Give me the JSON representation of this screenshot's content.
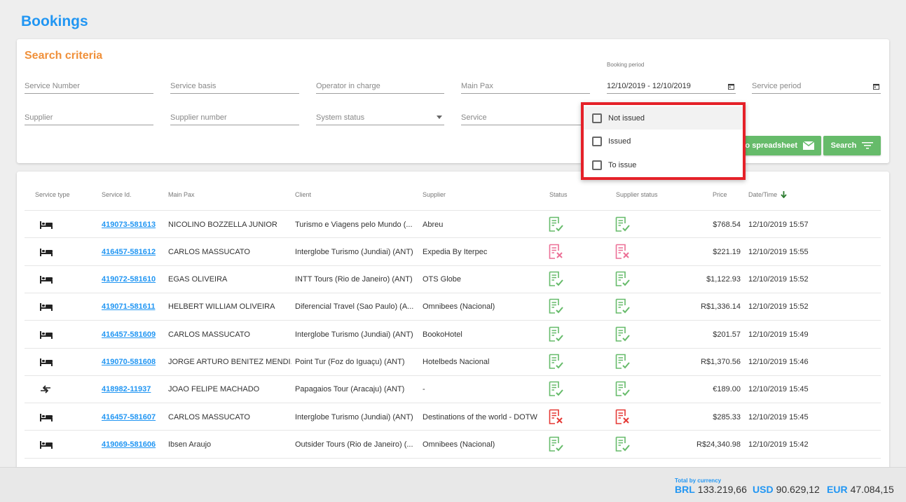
{
  "page_title": "Bookings",
  "search": {
    "title": "Search criteria",
    "service_number": "Service Number",
    "service_basis": "Service basis",
    "operator": "Operator in charge",
    "main_pax": "Main Pax",
    "booking_period_label": "Booking period",
    "booking_period_value": "12/10/2019 - 12/10/2019",
    "service_period": "Service period",
    "supplier": "Supplier",
    "supplier_number": "Supplier number",
    "system_status": "System status",
    "service": "Service",
    "export_button": "to spreadsheet",
    "search_button": "Search"
  },
  "dropdown": {
    "options": [
      "Not issued",
      "Issued",
      "To issue"
    ]
  },
  "table": {
    "headers": {
      "service_type": "Service type",
      "service_id": "Service Id.",
      "main_pax": "Main Pax",
      "client": "Client",
      "supplier": "Supplier",
      "status": "Status",
      "supplier_status": "Supplier status",
      "price": "Price",
      "datetime": "Date/Time"
    },
    "rows": [
      {
        "type": "bed-icon",
        "id": "419073-581613",
        "pax": "NICOLINO BOZZELLA JUNIOR",
        "client": "Turismo e Viagens pelo Mundo (...",
        "supplier": "Abreu",
        "status": "ok",
        "supplier_status": "ok",
        "price": "$768.54",
        "datetime": "12/10/2019 15:57"
      },
      {
        "type": "bed-icon",
        "id": "416457-581612",
        "pax": "CARLOS MASSUCATO",
        "client": "Interglobe Turismo (Jundiai) (ANT)",
        "supplier": "Expedia By Iterpec",
        "status": "cancel-pink",
        "supplier_status": "cancel-pink",
        "price": "$221.19",
        "datetime": "12/10/2019 15:55"
      },
      {
        "type": "bed-icon",
        "id": "419072-581610",
        "pax": "EGAS OLIVEIRA",
        "client": "INTT Tours (Rio de Janeiro) (ANT)",
        "supplier": "OTS Globe",
        "status": "ok",
        "supplier_status": "ok",
        "price": "$1,122.93",
        "datetime": "12/10/2019 15:52"
      },
      {
        "type": "bed-icon",
        "id": "419071-581611",
        "pax": "HELBERT WILLIAM OLIVEIRA",
        "client": "Diferencial Travel (Sao Paulo) (A...",
        "supplier": "Omnibees (Nacional)",
        "status": "ok",
        "supplier_status": "ok",
        "price": "R$1,336.14",
        "datetime": "12/10/2019 15:52"
      },
      {
        "type": "bed-icon",
        "id": "416457-581609",
        "pax": "CARLOS MASSUCATO",
        "client": "Interglobe Turismo (Jundiai) (ANT)",
        "supplier": "BookoHotel",
        "status": "ok",
        "supplier_status": "ok",
        "price": "$201.57",
        "datetime": "12/10/2019 15:49"
      },
      {
        "type": "bed-icon",
        "id": "419070-581608",
        "pax": "JORGE ARTURO BENITEZ MENDI...",
        "client": "Point Tur (Foz do Iguaçu) (ANT)",
        "supplier": "Hotelbeds Nacional",
        "status": "ok",
        "supplier_status": "ok",
        "price": "R$1,370.56",
        "datetime": "12/10/2019 15:46"
      },
      {
        "type": "transfer-icon",
        "id": "418982-11937",
        "pax": "JOAO FELIPE MACHADO",
        "client": "Papagaios Tour (Aracaju) (ANT)",
        "supplier": "-",
        "status": "ok",
        "supplier_status": "ok",
        "price": "€189.00",
        "datetime": "12/10/2019 15:45"
      },
      {
        "type": "bed-icon",
        "id": "416457-581607",
        "pax": "CARLOS MASSUCATO",
        "client": "Interglobe Turismo (Jundiai) (ANT)",
        "supplier": "Destinations of the world - DOTW",
        "status": "cancel-red",
        "supplier_status": "cancel-red",
        "price": "$285.33",
        "datetime": "12/10/2019 15:45"
      },
      {
        "type": "bed-icon",
        "id": "419069-581606",
        "pax": "Ibsen Araujo",
        "client": "Outsider Tours (Rio de Janeiro) (...",
        "supplier": "Omnibees (Nacional)",
        "status": "ok",
        "supplier_status": "ok",
        "price": "R$24,340.98",
        "datetime": "12/10/2019 15:42"
      }
    ]
  },
  "footer": {
    "total_label": "Total by currency",
    "totals": [
      {
        "code": "BRL",
        "amount": "133.219,66"
      },
      {
        "code": "USD",
        "amount": "90.629,12"
      },
      {
        "code": "EUR",
        "amount": "47.084,15"
      }
    ]
  },
  "colors": {
    "accent": "#2196f3",
    "search_title": "#f0903a",
    "button": "#66bb6a",
    "ok": "#66bb6a",
    "cancel_pink": "#ec6f96",
    "cancel_red": "#e53935",
    "highlight_border": "#e52129"
  }
}
